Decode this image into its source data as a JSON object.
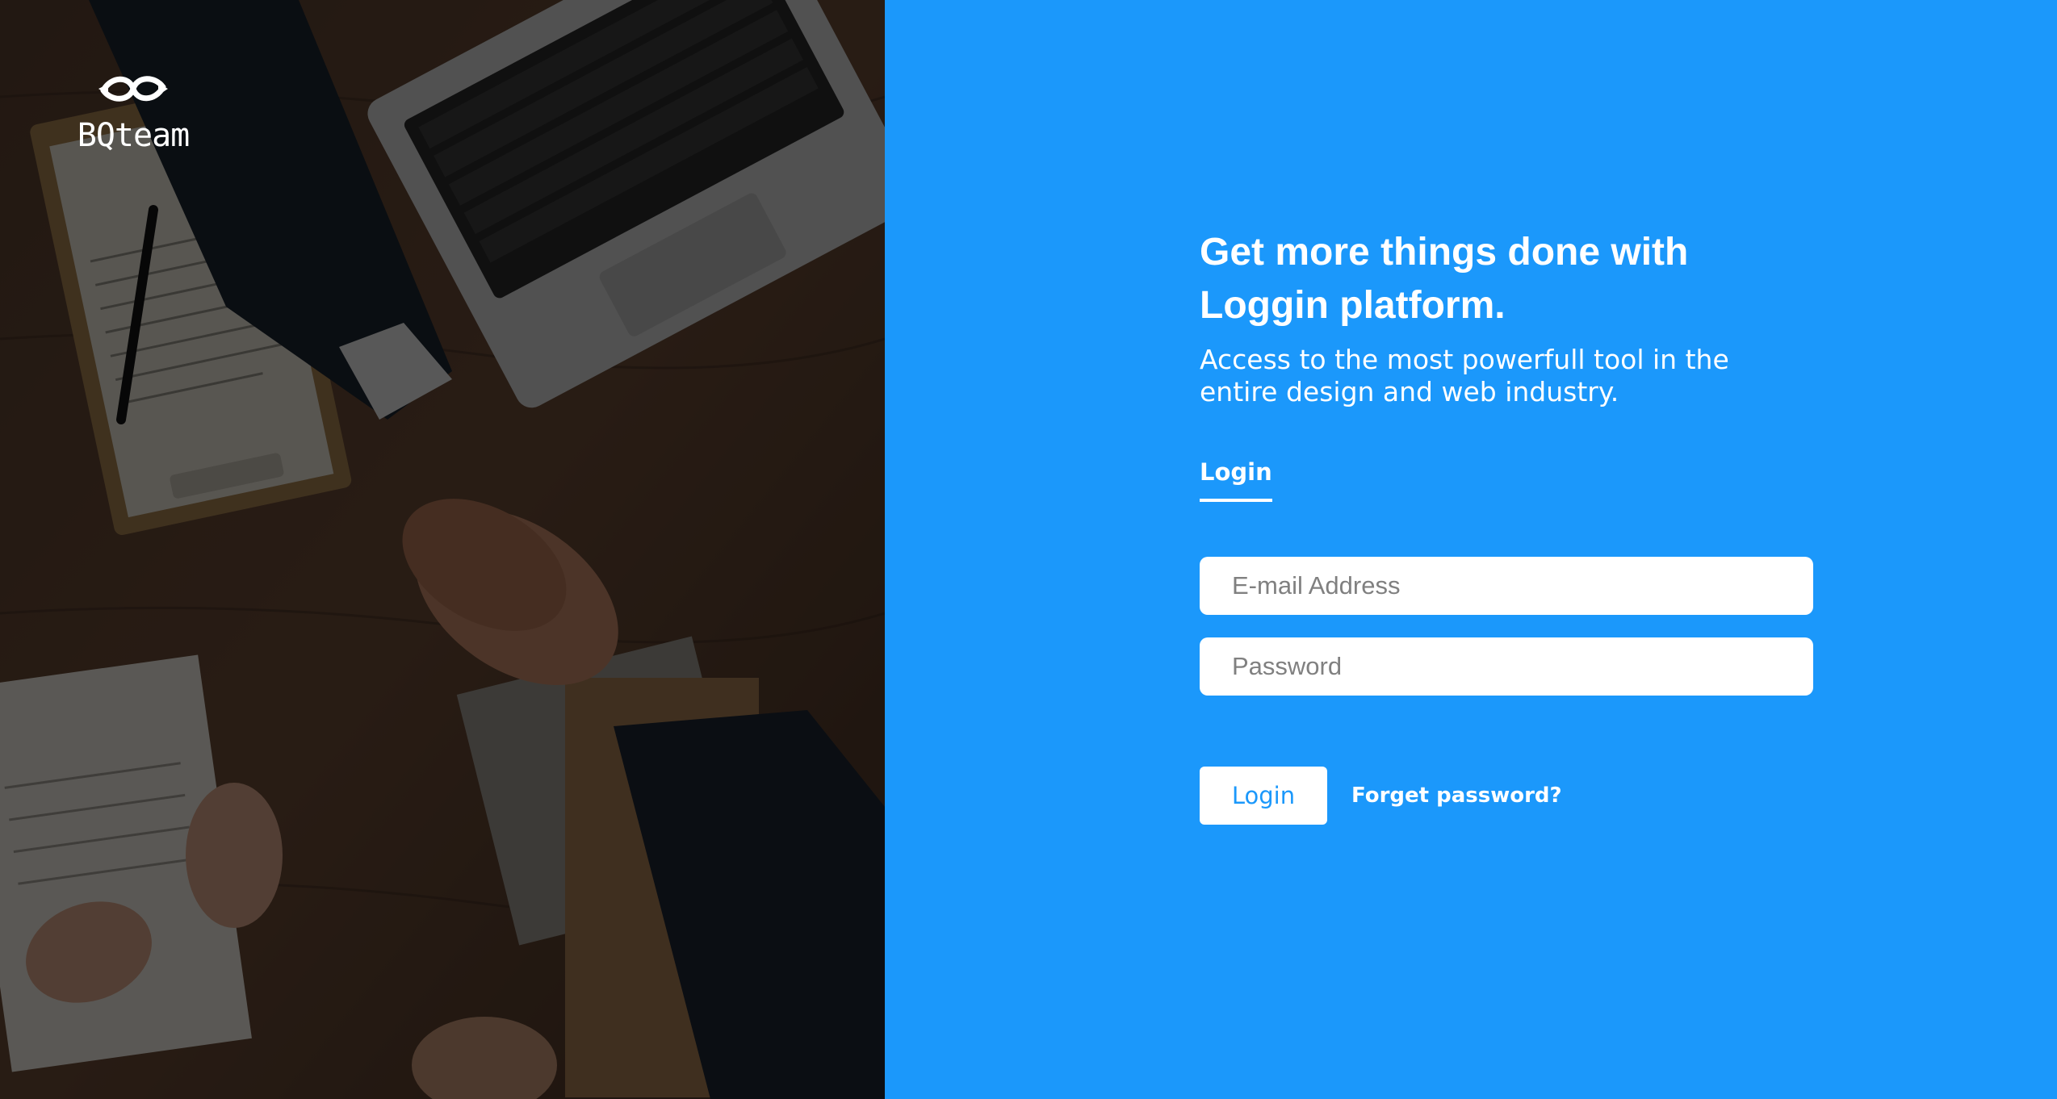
{
  "brand": {
    "logo_icon": "interlocking-rings-logo",
    "name": "BQteam"
  },
  "hero_image": {
    "subject": "handshake-over-desk-with-laptop-and-contract"
  },
  "main": {
    "headline": "Get more things done with Loggin platform.",
    "subheadline": "Access to the most powerfull tool in the entire design and web industry.",
    "tab_label": "Login",
    "email_placeholder": "E-mail Address",
    "password_placeholder": "Password",
    "login_button": "Login",
    "forgot_password": "Forget password?"
  },
  "colors": {
    "accent": "#1b98fb",
    "text_on_accent": "#ffffff",
    "overlay": "#000000"
  }
}
